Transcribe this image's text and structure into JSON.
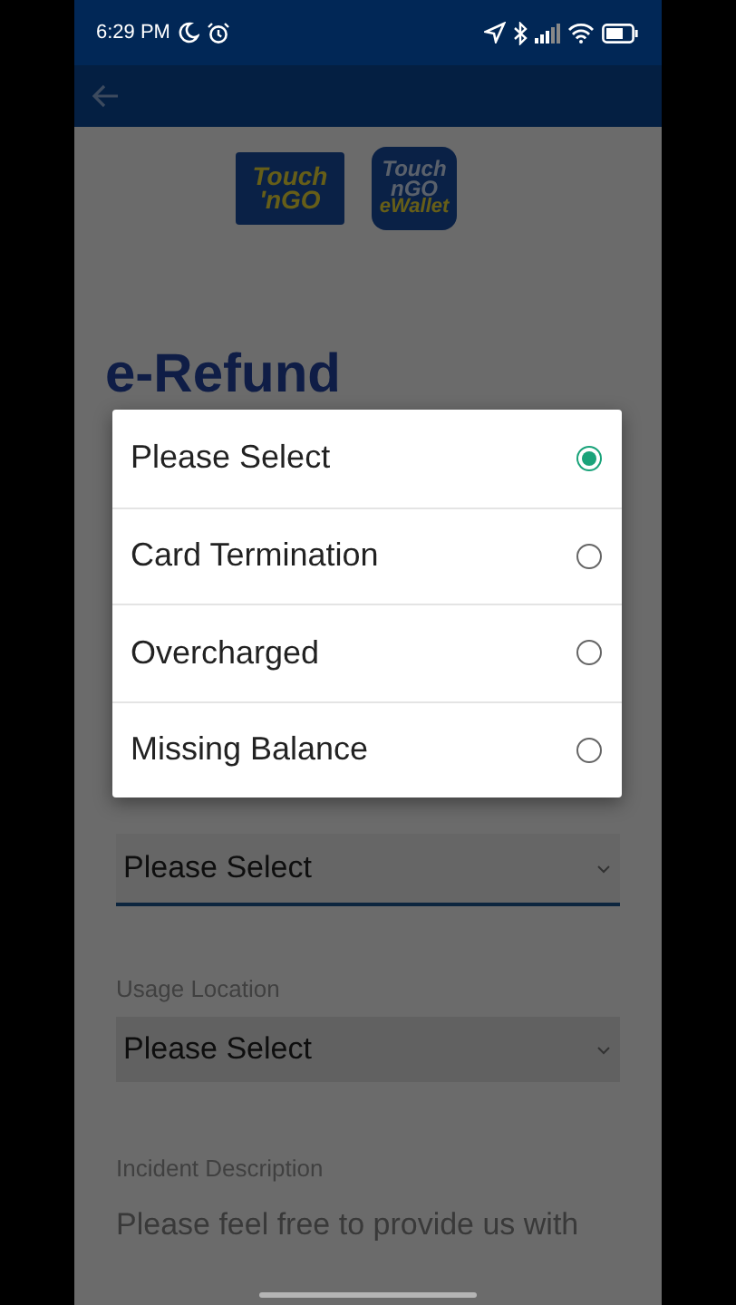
{
  "status_bar": {
    "time": "6:29 PM"
  },
  "logos": [
    {
      "kind": "card",
      "lines": [
        "Touch",
        "'nGO"
      ]
    },
    {
      "kind": "wallet",
      "lines": [
        "Touch",
        "nGO",
        "eWallet"
      ]
    }
  ],
  "title": "e-Refund",
  "form": {
    "fields": [
      {
        "value": "Please Select",
        "focused": true
      },
      {
        "label": "Usage Location",
        "value": "Please Select",
        "focused": false
      }
    ],
    "description": {
      "label": "Incident Description",
      "placeholder": "Please feel free to provide us with"
    }
  },
  "dialog": {
    "options": [
      {
        "label": "Please Select",
        "selected": true
      },
      {
        "label": "Card Termination",
        "selected": false
      },
      {
        "label": "Overcharged",
        "selected": false
      },
      {
        "label": "Missing Balance",
        "selected": false
      }
    ]
  }
}
